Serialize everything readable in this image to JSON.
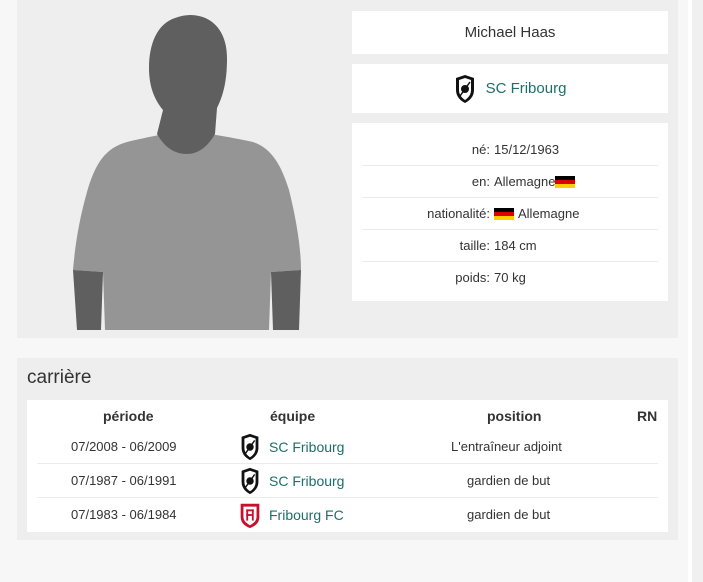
{
  "player": {
    "name": "Michael Haas",
    "club": "SC Fribourg"
  },
  "info": [
    {
      "label": "né:",
      "value": "15/12/1963",
      "flag": ""
    },
    {
      "label": "en:",
      "value": "Allemagne",
      "flag": "after"
    },
    {
      "label": "nationalité:",
      "value": "Allemagne",
      "flag": "before"
    },
    {
      "label": "taille:",
      "value": "184 cm",
      "flag": ""
    },
    {
      "label": "poids:",
      "value": "70 kg",
      "flag": ""
    }
  ],
  "career": {
    "title": "carrière",
    "headers": {
      "period": "période",
      "team": "équipe",
      "position": "position",
      "rn": "RN"
    },
    "rows": [
      {
        "period": "07/2008 - 06/2009",
        "team": "SC Fribourg",
        "crest": "scf-crest-icon",
        "position": "L'entraîneur adjoint",
        "rn": ""
      },
      {
        "period": "07/1987 - 06/1991",
        "team": "SC Fribourg",
        "crest": "scf-crest-icon",
        "position": "gardien de but",
        "rn": ""
      },
      {
        "period": "07/1983 - 06/1984",
        "team": "Fribourg FC",
        "crest": "fribourg-fc-crest-icon",
        "position": "gardien de but",
        "rn": ""
      }
    ]
  },
  "colors": {
    "link": "#1d6f6a",
    "panel": "#eeeeee",
    "silhouette_head": "#5f5f5f",
    "silhouette_body": "#959595"
  }
}
